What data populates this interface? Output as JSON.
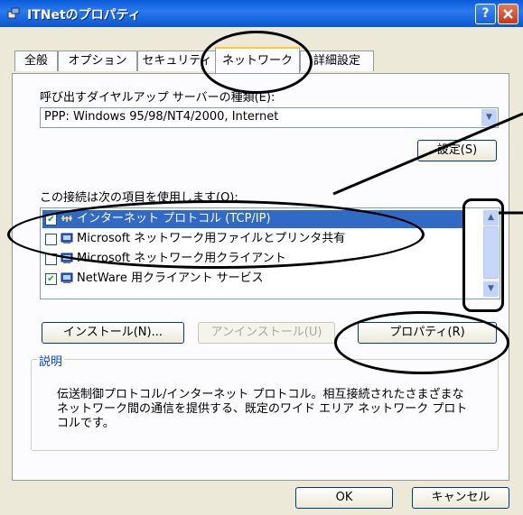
{
  "window": {
    "title": "ITNetのプロパティ",
    "help_button": "?",
    "close_button": "X"
  },
  "tabs": [
    "全般",
    "オプション",
    "セキュリティ",
    "ネットワーク",
    "詳細設定"
  ],
  "active_tab": "ネットワーク",
  "dialup_server": {
    "label": "呼び出すダイヤルアップ サーバーの種類(E):",
    "value": "PPP: Windows 95/98/NT4/2000, Internet",
    "settings_button": "設定(S)"
  },
  "components": {
    "label": "この接続は次の項目を使用します(O):",
    "items": [
      {
        "label": "インターネット プロトコル (TCP/IP)",
        "checked": true,
        "selected": true
      },
      {
        "label": "Microsoft ネットワーク用ファイルとプリンタ共有",
        "checked": false,
        "selected": false
      },
      {
        "label": "Microsoft ネットワーク用クライアント",
        "checked": false,
        "selected": false
      },
      {
        "label": "NetWare 用クライアント サービス",
        "checked": true,
        "selected": false
      }
    ]
  },
  "buttons": {
    "install": "インストール(N)...",
    "uninstall": "アンインストール(U)",
    "properties": "プロパティ(R)"
  },
  "description": {
    "title": "説明",
    "text_lines": [
      "伝送制御プロトコル/インターネット プロトコル。相互接続されたさまざまな",
      "ネットワーク間の通信を提供する、既定のワイド エリア ネットワーク プロト",
      "コルです。"
    ]
  },
  "footer": {
    "ok": "OK",
    "cancel": "キャンセル"
  },
  "colors": {
    "titlebar": "#0a5bd8",
    "selection": "#316ac5",
    "dialog": "#ece9d8",
    "tab_highlight": "#ffc83c"
  }
}
